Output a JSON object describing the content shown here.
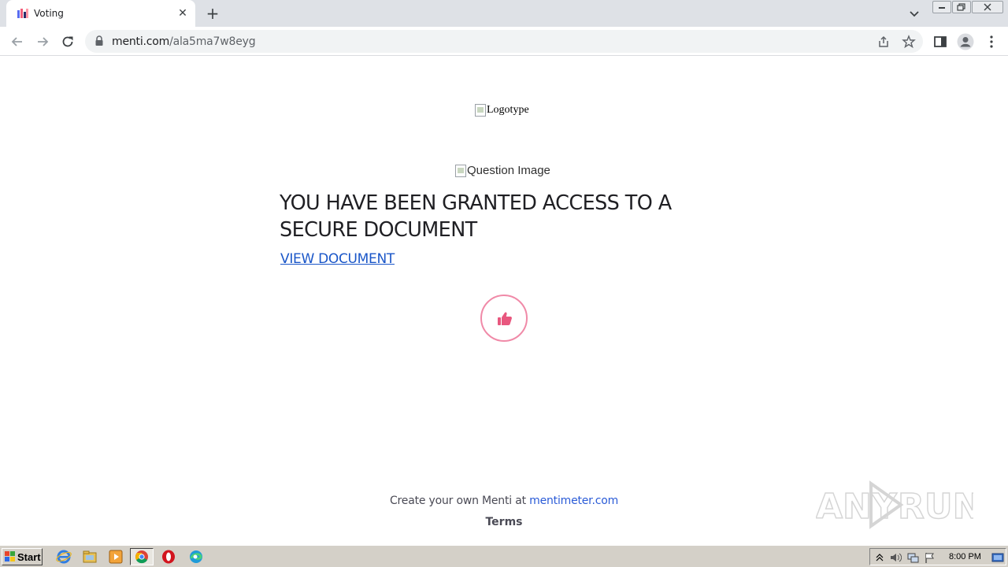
{
  "browser": {
    "tab": {
      "title": "Voting"
    },
    "url": {
      "host": "menti.com",
      "path": "/ala5ma7w8eyg"
    }
  },
  "page": {
    "logo_alt": "Logotype",
    "question_image_alt": "Question Image",
    "headline": "YOU HAVE BEEN GRANTED ACCESS TO A SECURE DOCUMENT",
    "view_link": "VIEW DOCUMENT",
    "footer": {
      "prefix": "Create your own Menti at ",
      "link": "mentimeter.com",
      "terms": "Terms"
    },
    "accent_color": "#f08aa8"
  },
  "watermark": {
    "text": "ANY RUN"
  },
  "taskbar": {
    "start_label": "Start",
    "apps": [
      "ie-icon",
      "explorer-icon",
      "media-player-icon",
      "chrome-icon",
      "opera-icon",
      "edge-icon"
    ],
    "clock": "8:00 PM"
  }
}
